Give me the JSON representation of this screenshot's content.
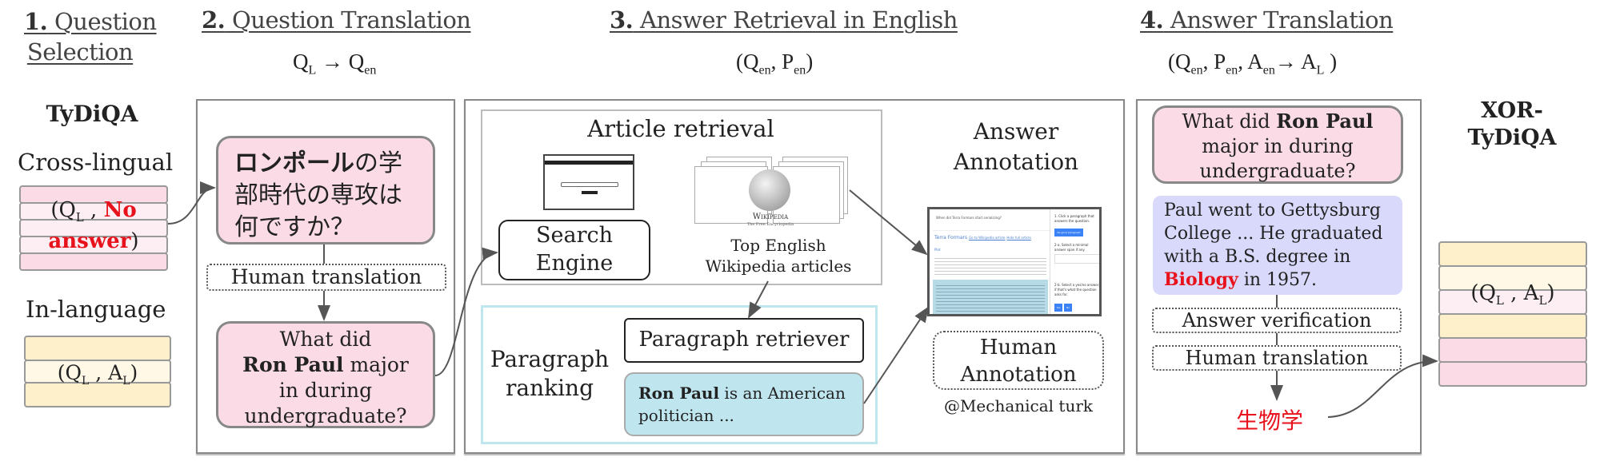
{
  "stages": [
    {
      "number": "1.",
      "title_line1": "Question",
      "title_line2": "Selection"
    },
    {
      "number": "2.",
      "title": "Question Translation",
      "formula": {
        "from": "Q",
        "from_sub": "L",
        "arrow": "→",
        "to": "Q",
        "to_sub": "en"
      }
    },
    {
      "number": "3.",
      "title": "Answer Retrieval in English",
      "formula": {
        "open": "(",
        "a": "Q",
        "a_sub": "en",
        "sep": ", ",
        "b": "P",
        "b_sub": "en",
        "close": ")"
      }
    },
    {
      "number": "4.",
      "title": "Answer Translation",
      "formula": {
        "open": "(",
        "a": "Q",
        "a_sub": "en",
        "b": "P",
        "b_sub": "en",
        "c": "A",
        "c_sub": "en",
        "arrow": "→",
        "d": "A",
        "d_sub": "L",
        "close": ")",
        "sep": ", "
      }
    }
  ],
  "source": {
    "title": "TyDiQA",
    "cross_lingual": {
      "label": "Cross-lingual",
      "pair_open": "(Q",
      "pair_sub": "L",
      "pair_sep": " , ",
      "no": "No",
      "answer": "answer",
      "pair_close": ")"
    },
    "in_language": {
      "label": "In-language",
      "pair_open": "(Q",
      "pair_sub1": "L",
      "pair_mid": " , A",
      "pair_sub2": "L",
      "pair_close": ")"
    }
  },
  "question_translation": {
    "jp_question_bold": "ロンポール",
    "jp_question_rest_1": "の学",
    "jp_question_line2": "部時代の専攻は",
    "jp_question_line3": "何ですか？",
    "human_translation": "Human translation",
    "en_q_line1": "What did",
    "en_q_bold": "Ron Paul",
    "en_q_line2_rest": " major",
    "en_q_line3": "in during",
    "en_q_line4": "undergraduate?"
  },
  "retrieval": {
    "article_retrieval": "Article retrieval",
    "search_engine_line1": "Search",
    "search_engine_line2": "Engine",
    "wikipedia_wordmark": "Wikipedia",
    "wikipedia_tagline": "The Free Encyclopedia",
    "top_articles_line1": "Top English",
    "top_articles_line2": "Wikipedia articles",
    "paragraph_ranking_line1": "Paragraph",
    "paragraph_ranking_line2": "ranking",
    "paragraph_retriever": "Paragraph retriever",
    "paragraph_bold": "Ron Paul",
    "paragraph_rest": " is an American",
    "paragraph_line2": "politician ...",
    "answer_annotation_line1": "Answer",
    "answer_annotation_line2": "Annotation",
    "human_annotation_line1": "Human",
    "human_annotation_line2": "Annotation",
    "mechanical_turk": "@Mechanical turk",
    "annotation_ui": {
      "question": "When did Terra Formars start serializing?",
      "article_title": "Terra Formars",
      "links": [
        "Go to Wikipedia article",
        "Hide full article"
      ],
      "section": "Plot",
      "step1": "1. Click a paragraph that answers the question.",
      "no_good_paragraph": "No good paragraph",
      "step2a": "2-a. Select a minimal answer span if any.",
      "step2b": "2-b. Select a yes/no answer, if that's what the question asks for.",
      "yes": "Yes",
      "no": "No"
    }
  },
  "answer_translation": {
    "q_pre": "What did ",
    "q_bold": "Ron Paul",
    "q_line2": "major in during",
    "q_line3": "undergraduate?",
    "passage_line1": "Paul went to Gettysburg",
    "passage_line2": "College ... He  graduated",
    "passage_line3": "with a B.S. degree in",
    "passage_answer": "Biology",
    "passage_rest": " in 1957.",
    "answer_verification": "Answer verification",
    "human_translation": "Human translation",
    "translated_answer": "生物学"
  },
  "output": {
    "title_line1": "XOR-",
    "title_line2": "TyDiQA",
    "pair_open": "(Q",
    "pair_sub1": "L",
    "pair_mid": " , A",
    "pair_sub2": "L",
    "pair_close": ")"
  },
  "colors": {
    "pink": "#fbdce6",
    "light_pink": "#fdeef3",
    "yellow": "#fff0cc",
    "light_yellow": "#fff8e6",
    "blue_paragraph": "#bfe6ef",
    "lavender_passage": "#d8d9fb",
    "answer_red": "#e8121c"
  }
}
